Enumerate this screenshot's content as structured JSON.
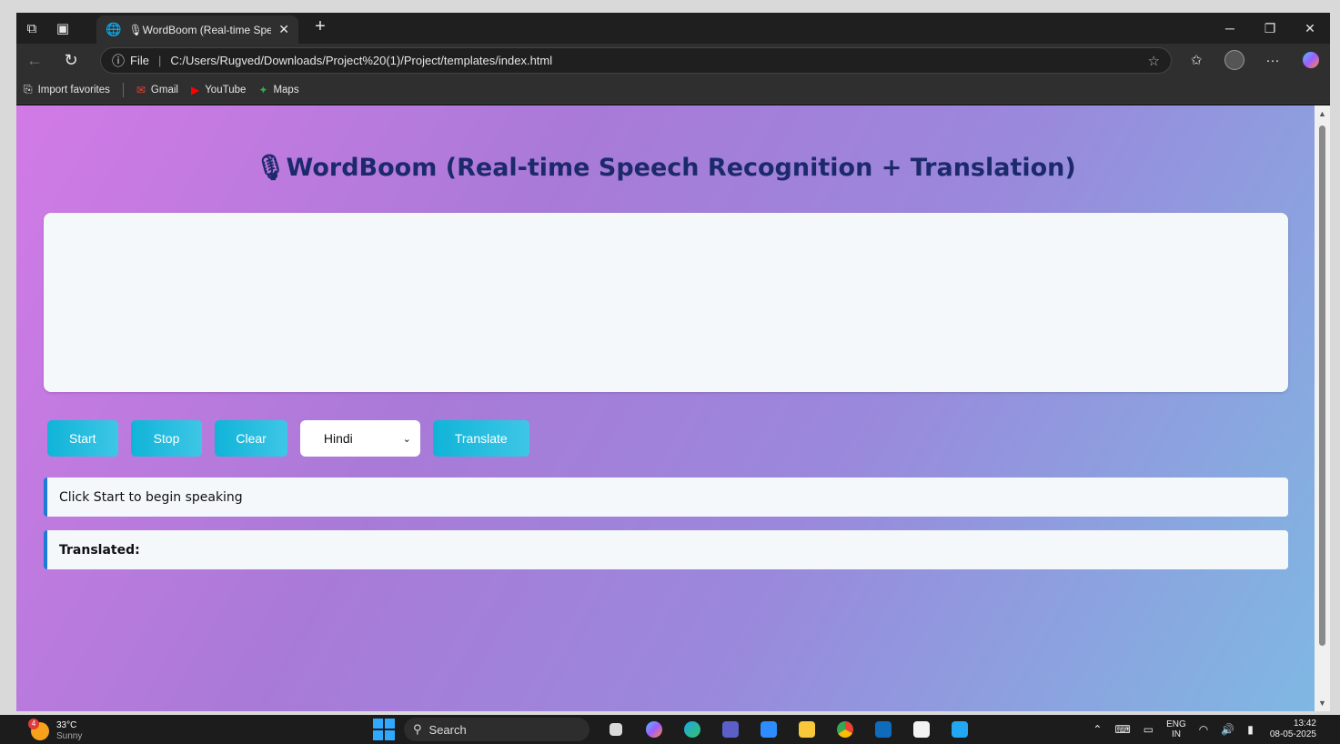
{
  "browser": {
    "tab_title": "🎙WordBoom (Real-time Speech",
    "address_label": "File",
    "url": "C:/Users/Rugved/Downloads/Project%20(1)/Project/templates/index.html",
    "favorites": [
      {
        "label": "Import favorites",
        "icon": "import-icon"
      },
      {
        "label": "Gmail",
        "icon": "gmail-icon"
      },
      {
        "label": "YouTube",
        "icon": "youtube-icon"
      },
      {
        "label": "Maps",
        "icon": "maps-icon"
      }
    ]
  },
  "page": {
    "title": "🎙WordBoom (Real-time Speech Recognition + Translation)",
    "transcript_text": "",
    "buttons": {
      "start": "Start",
      "stop": "Stop",
      "clear": "Clear",
      "translate": "Translate"
    },
    "language_selected": "Hindi",
    "status_text": "Click Start to begin speaking",
    "translated_label": "Translated:"
  },
  "taskbar": {
    "weather_temp": "33°C",
    "weather_cond": "Sunny",
    "weather_badge": "4",
    "search_placeholder": "Search",
    "lang_top": "ENG",
    "lang_bottom": "IN",
    "time": "13:42",
    "date": "08-05-2025"
  },
  "colors": {
    "accent_button": "#10b4d8",
    "heading": "#1c2a6b",
    "status_border": "#1b7bd6"
  }
}
